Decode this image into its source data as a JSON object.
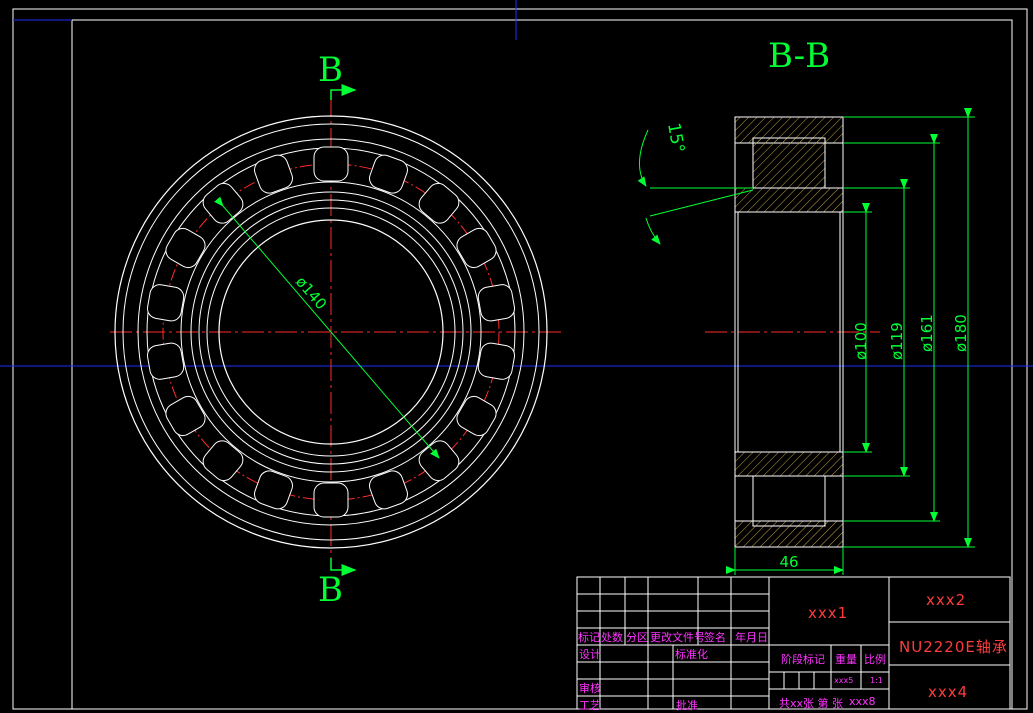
{
  "section_title": "B-B",
  "cut_marks": {
    "top": "B",
    "bottom": "B"
  },
  "dimensions": {
    "pitch_diameter": "ø140",
    "bore": "ø100",
    "inner_race": "ø119",
    "outer_race": "ø161",
    "outside": "ø180",
    "width": "46",
    "angle": "15°"
  },
  "title_block": {
    "field1": "xxx1",
    "field2": "xxx2",
    "part_name": "NU2220E轴承",
    "field4": "xxx4",
    "field5": "xxx5",
    "scale_value": "1:1",
    "field8": "xxx8",
    "sheet_text": "共xx张 第  张",
    "header_labels": [
      "标记",
      "处数",
      "分区",
      "更改文件号",
      "签名",
      "年月日"
    ],
    "design": "设计",
    "standardize": "标准化",
    "stage_mark": "阶段标记",
    "weight": "重量",
    "scale": "比例",
    "review": "审核",
    "process": "工艺",
    "approve": "批准"
  },
  "colors": {
    "line": "#ffffff",
    "centerline": "#ff2a2a",
    "dimension": "#00ff33",
    "frame": "#1f2bff",
    "hatch": "#c8a24a",
    "title_text": "#ff33ff",
    "title_text_red": "#ff3b3b"
  }
}
